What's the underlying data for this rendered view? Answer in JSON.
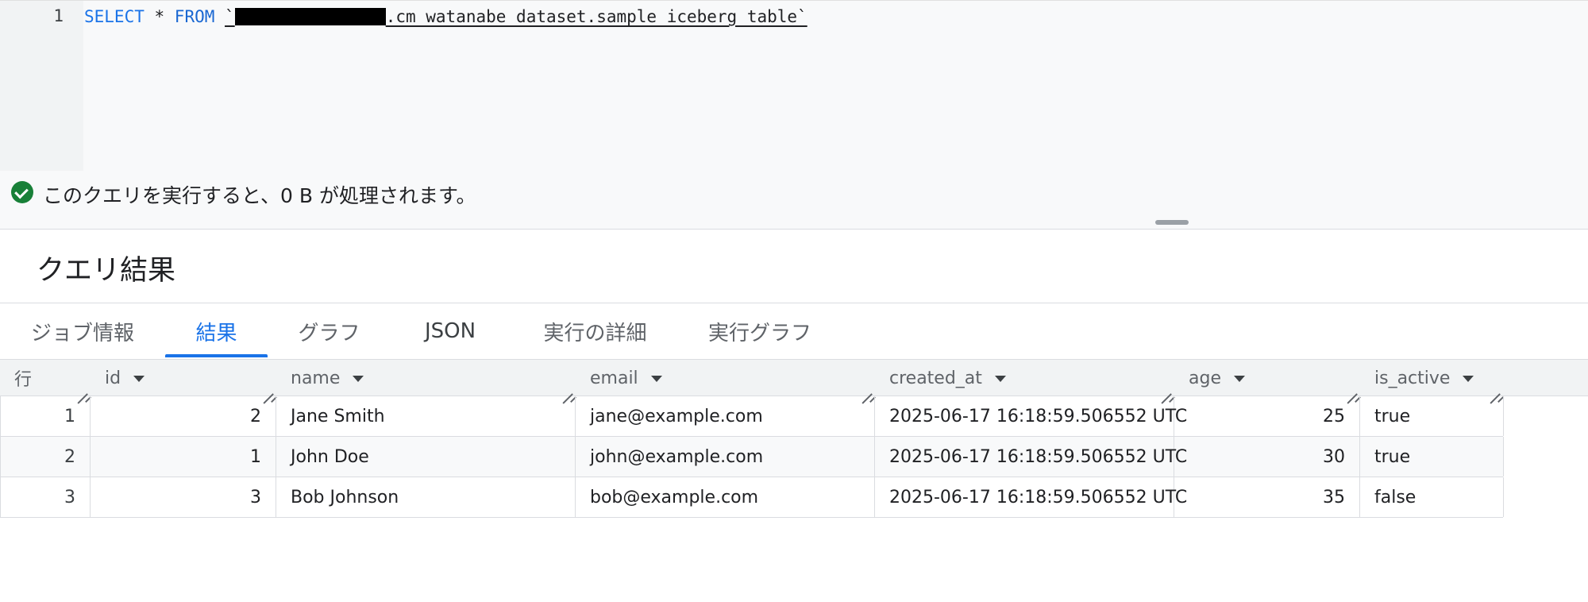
{
  "editor": {
    "line_number": "1",
    "select_kw": "SELECT",
    "star": " * ",
    "from_kw": "FROM",
    "table_ref_suffix": ".cm_watanabe_dataset.sample_iceberg_table`"
  },
  "validator": {
    "message": "このクエリを実行すると、0 B が処理されます。",
    "status_color": "#188038"
  },
  "results": {
    "title": "クエリ結果",
    "tabs": [
      {
        "label": "ジョブ情報"
      },
      {
        "label": "結果"
      },
      {
        "label": "グラフ"
      },
      {
        "label": "JSON"
      },
      {
        "label": "実行の詳細"
      },
      {
        "label": "実行グラフ"
      }
    ],
    "active_tab": "結果",
    "accent_color": "#1a73e8"
  },
  "grid": {
    "row_header": "行",
    "columns": [
      "id",
      "name",
      "email",
      "created_at",
      "age",
      "is_active"
    ],
    "rows": [
      {
        "row": "1",
        "id": "2",
        "name": "Jane Smith",
        "email": "jane@example.com",
        "created_at": "2025-06-17 16:18:59.506552 UTC",
        "age": "25",
        "is_active": "true"
      },
      {
        "row": "2",
        "id": "1",
        "name": "John Doe",
        "email": "john@example.com",
        "created_at": "2025-06-17 16:18:59.506552 UTC",
        "age": "30",
        "is_active": "true"
      },
      {
        "row": "3",
        "id": "3",
        "name": "Bob Johnson",
        "email": "bob@example.com",
        "created_at": "2025-06-17 16:18:59.506552 UTC",
        "age": "35",
        "is_active": "false"
      }
    ]
  }
}
